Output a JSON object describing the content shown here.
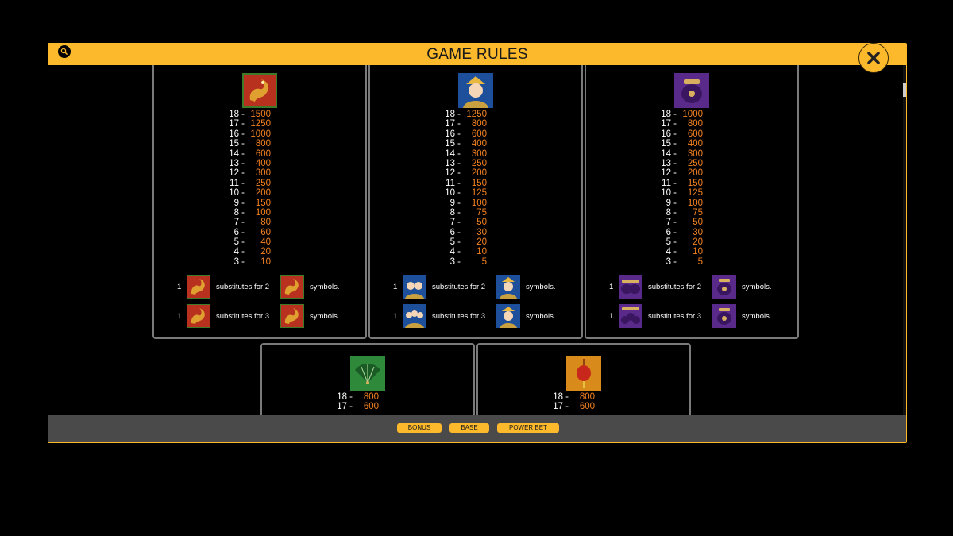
{
  "header": {
    "title": "GAME RULES",
    "search_icon": "search-icon",
    "close_icon": "close-icon"
  },
  "colors": {
    "accent": "#fdb92c",
    "payout": "#f58220",
    "panel_border": "#7a7a7a",
    "footer": "#4a4a4a"
  },
  "panels": [
    {
      "symbol": "dragon",
      "payouts": [
        {
          "count": "18",
          "amount": "1500"
        },
        {
          "count": "17",
          "amount": "1250"
        },
        {
          "count": "16",
          "amount": "1000"
        },
        {
          "count": "15",
          "amount": "800"
        },
        {
          "count": "14",
          "amount": "600"
        },
        {
          "count": "13",
          "amount": "400"
        },
        {
          "count": "12",
          "amount": "300"
        },
        {
          "count": "11",
          "amount": "250"
        },
        {
          "count": "10",
          "amount": "200"
        },
        {
          "count": "9",
          "amount": "150"
        },
        {
          "count": "8",
          "amount": "100"
        },
        {
          "count": "7",
          "amount": "80"
        },
        {
          "count": "6",
          "amount": "60"
        },
        {
          "count": "5",
          "amount": "40"
        },
        {
          "count": "4",
          "amount": "20"
        },
        {
          "count": "3",
          "amount": "10"
        }
      ],
      "subs": [
        {
          "count": "1",
          "text": "substitutes for 2",
          "end": "symbols."
        },
        {
          "count": "1",
          "text": "substitutes for 3",
          "end": "symbols."
        }
      ]
    },
    {
      "symbol": "empress",
      "payouts": [
        {
          "count": "18",
          "amount": "1250"
        },
        {
          "count": "17",
          "amount": "800"
        },
        {
          "count": "16",
          "amount": "600"
        },
        {
          "count": "15",
          "amount": "400"
        },
        {
          "count": "14",
          "amount": "300"
        },
        {
          "count": "13",
          "amount": "250"
        },
        {
          "count": "12",
          "amount": "200"
        },
        {
          "count": "11",
          "amount": "150"
        },
        {
          "count": "10",
          "amount": "125"
        },
        {
          "count": "9",
          "amount": "100"
        },
        {
          "count": "8",
          "amount": "75"
        },
        {
          "count": "7",
          "amount": "50"
        },
        {
          "count": "6",
          "amount": "30"
        },
        {
          "count": "5",
          "amount": "20"
        },
        {
          "count": "4",
          "amount": "10"
        },
        {
          "count": "3",
          "amount": "5"
        }
      ],
      "subs": [
        {
          "count": "1",
          "text": "substitutes for 2",
          "end": "symbols."
        },
        {
          "count": "1",
          "text": "substitutes for 3",
          "end": "symbols."
        }
      ]
    },
    {
      "symbol": "pot",
      "payouts": [
        {
          "count": "18",
          "amount": "1000"
        },
        {
          "count": "17",
          "amount": "800"
        },
        {
          "count": "16",
          "amount": "600"
        },
        {
          "count": "15",
          "amount": "400"
        },
        {
          "count": "14",
          "amount": "300"
        },
        {
          "count": "13",
          "amount": "250"
        },
        {
          "count": "12",
          "amount": "200"
        },
        {
          "count": "11",
          "amount": "150"
        },
        {
          "count": "10",
          "amount": "125"
        },
        {
          "count": "9",
          "amount": "100"
        },
        {
          "count": "8",
          "amount": "75"
        },
        {
          "count": "7",
          "amount": "50"
        },
        {
          "count": "6",
          "amount": "30"
        },
        {
          "count": "5",
          "amount": "20"
        },
        {
          "count": "4",
          "amount": "10"
        },
        {
          "count": "3",
          "amount": "5"
        }
      ],
      "subs": [
        {
          "count": "1",
          "text": "substitutes for 2",
          "end": "symbols."
        },
        {
          "count": "1",
          "text": "substitutes for 3",
          "end": "symbols."
        }
      ]
    },
    {
      "symbol": "fan",
      "payouts": [
        {
          "count": "18",
          "amount": "800"
        },
        {
          "count": "17",
          "amount": "600"
        }
      ]
    },
    {
      "symbol": "lantern",
      "payouts": [
        {
          "count": "18",
          "amount": "800"
        },
        {
          "count": "17",
          "amount": "600"
        }
      ]
    }
  ],
  "footer": {
    "buttons": [
      "BONUS",
      "BASE",
      "POWER BET"
    ]
  }
}
